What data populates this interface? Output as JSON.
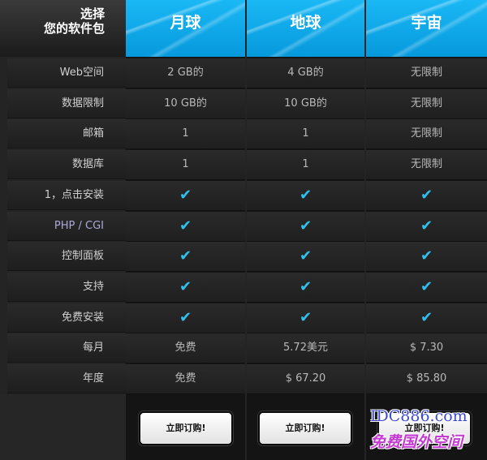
{
  "corner": {
    "line1": "选择",
    "line2": "您的软件包"
  },
  "features": [
    "Web空间",
    "数据限制",
    "邮箱",
    "数据库",
    "1，点击安装",
    "PHP / CGI",
    "控制面板",
    "支持",
    "免费安装",
    "每月",
    "年度"
  ],
  "check_symbol": "✔",
  "check_color": "#2fc0ee",
  "header_color": "#0aa3e6",
  "plans": [
    {
      "name": "月球",
      "values": [
        "2 GB的",
        "10 GB的",
        "1",
        "1",
        "✔",
        "✔",
        "✔",
        "✔",
        "✔",
        "免费",
        "免费"
      ],
      "order_label": "立即订购!"
    },
    {
      "name": "地球",
      "values": [
        "4 GB的",
        "10 GB的",
        "1",
        "1",
        "✔",
        "✔",
        "✔",
        "✔",
        "✔",
        "5.72美元",
        "$ 67.20"
      ],
      "order_label": "立即订购!"
    },
    {
      "name": "宇宙",
      "values": [
        "无限制",
        "无限制",
        "无限制",
        "无限制",
        "✔",
        "✔",
        "✔",
        "✔",
        "✔",
        "$ 7.30",
        "$ 85.80"
      ],
      "order_label": "立即订购!"
    }
  ],
  "watermark": {
    "line1": "IDC886.com",
    "line2": "免费国外空间"
  }
}
